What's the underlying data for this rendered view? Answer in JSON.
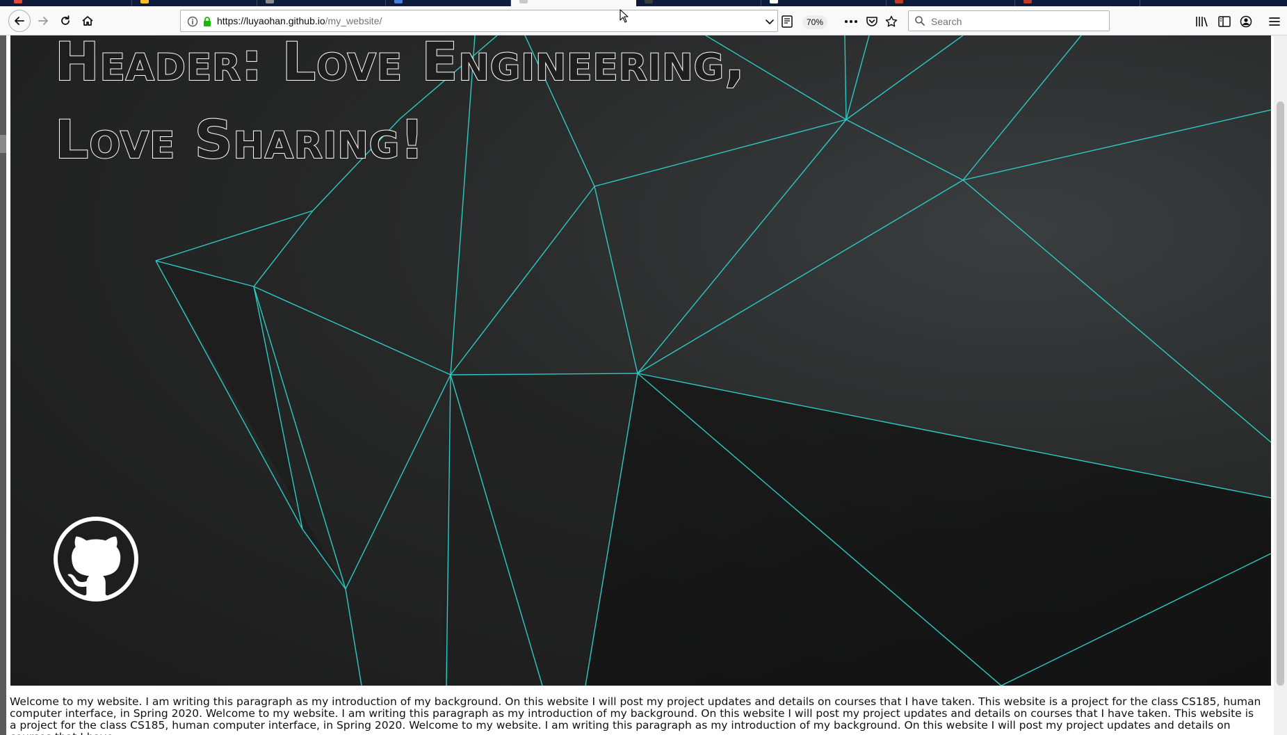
{
  "browser": {
    "url_host": "https://luyaohan.github.io",
    "url_path": "/my_website/",
    "zoom": "70%",
    "search_placeholder": "Search"
  },
  "page": {
    "title_line1": "Header: Love Engineering,",
    "title_line2": "Love Sharing!",
    "intro": "Welcome to my website. I am writing this paragraph as my introduction of my background. On this website I will post my project updates and details on courses that I have taken. This website is a project for the class CS185, human computer interface, in Spring 2020. Welcome to my website. I am writing this paragraph as my introduction of my background. On this website I will post my project updates and details on courses that I have taken. This website is a project for the class CS185, human computer interface, in Spring 2020. Welcome to my website. I am writing this paragraph as my introduction of my background. On this website I will post my project updates and details on courses that I have"
  },
  "colors": {
    "mesh_line": "#2ec9c4",
    "hero_bg": "#272828",
    "toolbar_bg": "#f9f9fa"
  },
  "icons": {
    "back": "back-arrow-icon",
    "forward": "forward-arrow-icon",
    "reload": "reload-icon",
    "home": "home-icon",
    "github": "github-icon"
  }
}
